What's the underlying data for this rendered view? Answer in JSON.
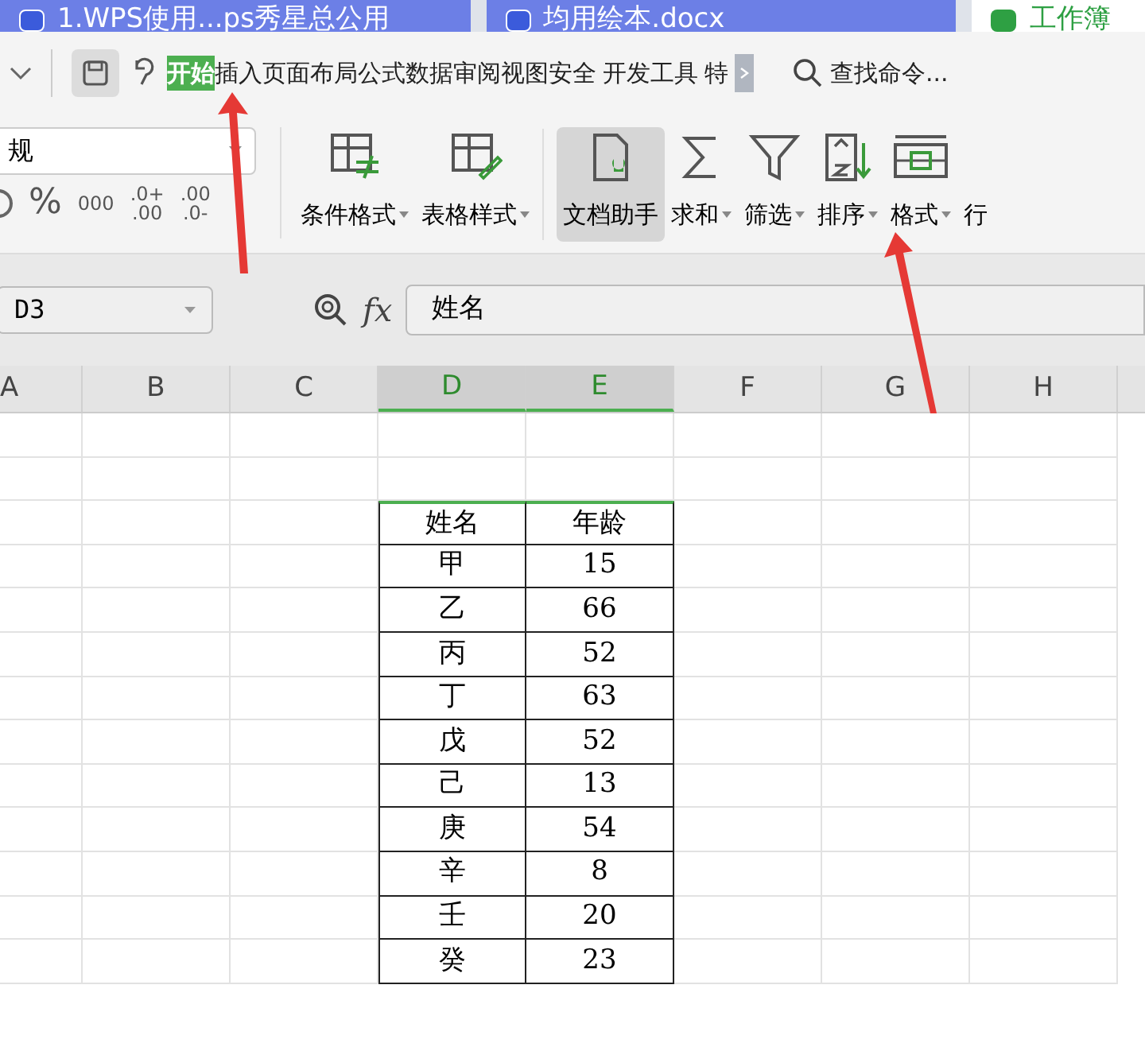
{
  "tabs": [
    {
      "label": "1.WPS使用...ps秀星总公用",
      "kind": "doc",
      "selected": false
    },
    {
      "label": "均用绘本.docx",
      "kind": "doc",
      "selected": false
    },
    {
      "label": "工作簿",
      "kind": "sheet",
      "selected": true
    }
  ],
  "menu": [
    {
      "label": "开始",
      "selected": true
    },
    {
      "label": "插入",
      "selected": false
    },
    {
      "label": "页面布局",
      "selected": false
    },
    {
      "label": "公式",
      "selected": false
    },
    {
      "label": "数据",
      "selected": false
    },
    {
      "label": "审阅",
      "selected": false
    },
    {
      "label": "视图",
      "selected": false
    },
    {
      "label": "安全",
      "selected": false
    },
    {
      "label": "开发工具",
      "selected": false
    },
    {
      "label": "特",
      "selected": false
    }
  ],
  "search": {
    "label": "查找命令..."
  },
  "ribbon": {
    "format_value": "规",
    "number_buttons": [
      "%",
      "000",
      ".0+\n.00",
      ".00\n.0-"
    ],
    "tools": [
      {
        "label": "条件格式",
        "kind": "cond",
        "dropdown": true,
        "selected": false
      },
      {
        "label": "表格样式",
        "kind": "style",
        "dropdown": true,
        "selected": false
      },
      {
        "label": "文档助手",
        "kind": "helper",
        "dropdown": false,
        "selected": true
      },
      {
        "label": "求和",
        "kind": "sum",
        "dropdown": true,
        "selected": false
      },
      {
        "label": "筛选",
        "kind": "filter",
        "dropdown": true,
        "selected": false
      },
      {
        "label": "排序",
        "kind": "sort",
        "dropdown": true,
        "selected": false
      },
      {
        "label": "格式",
        "kind": "format",
        "dropdown": true,
        "selected": false
      },
      {
        "label": "行",
        "kind": "cut",
        "dropdown": false,
        "selected": false
      }
    ]
  },
  "name_box": "D3",
  "fx": "fx",
  "formula": "姓名",
  "columns": [
    {
      "label": "A",
      "selected": false
    },
    {
      "label": "B",
      "selected": false
    },
    {
      "label": "C",
      "selected": false
    },
    {
      "label": "D",
      "selected": true
    },
    {
      "label": "E",
      "selected": true
    },
    {
      "label": "F",
      "selected": false
    },
    {
      "label": "G",
      "selected": false
    },
    {
      "label": "H",
      "selected": false
    }
  ],
  "table": {
    "header": [
      "姓名",
      "年龄"
    ],
    "rows": [
      [
        "甲",
        "15"
      ],
      [
        "乙",
        "66"
      ],
      [
        "丙",
        "52"
      ],
      [
        "丁",
        "63"
      ],
      [
        "戊",
        "52"
      ],
      [
        "己",
        "13"
      ],
      [
        "庚",
        "54"
      ],
      [
        "辛",
        "8"
      ],
      [
        "壬",
        "20"
      ],
      [
        "癸",
        "23"
      ]
    ]
  }
}
